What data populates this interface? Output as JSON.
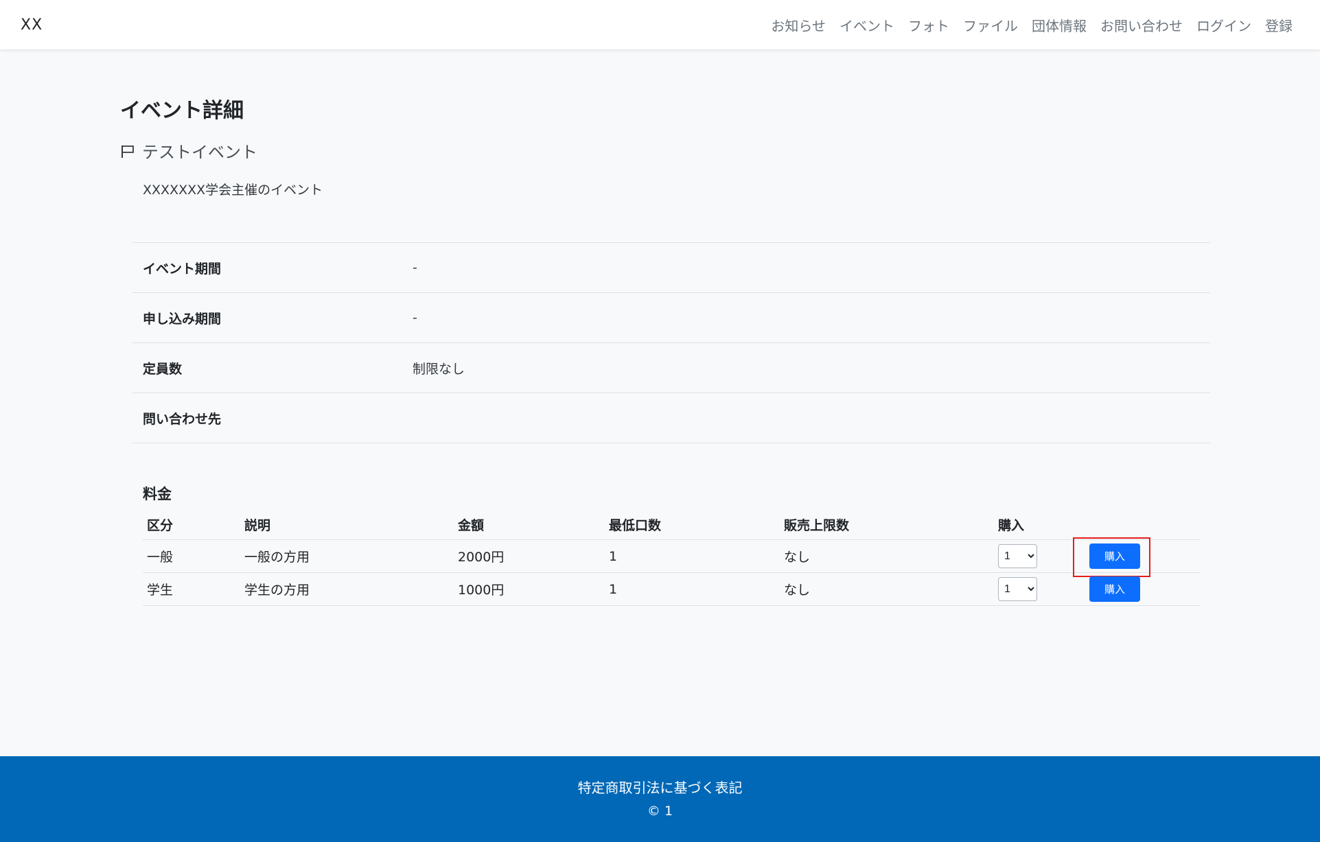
{
  "nav": {
    "brand": "XX",
    "links": [
      "お知らせ",
      "イベント",
      "フォト",
      "ファイル",
      "団体情報",
      "お問い合わせ",
      "ログイン",
      "登録"
    ]
  },
  "page": {
    "title": "イベント詳細",
    "event_name": "テストイベント",
    "event_description": "XXXXXXX学会主催のイベント"
  },
  "info": [
    {
      "label": "イベント期間",
      "value": "-"
    },
    {
      "label": "申し込み期間",
      "value": "-"
    },
    {
      "label": "定員数",
      "value": "制限なし"
    },
    {
      "label": "問い合わせ先",
      "value": ""
    }
  ],
  "pricing": {
    "title": "料金",
    "headers": [
      "区分",
      "説明",
      "金額",
      "最低口数",
      "販売上限数",
      "購入"
    ],
    "rows": [
      {
        "category": "一般",
        "description": "一般の方用",
        "amount": "2000円",
        "min_units": "1",
        "limit": "なし",
        "qty": "1",
        "buy_label": "購入"
      },
      {
        "category": "学生",
        "description": "学生の方用",
        "amount": "1000円",
        "min_units": "1",
        "limit": "なし",
        "qty": "1",
        "buy_label": "購入"
      }
    ]
  },
  "footer": {
    "link": "特定商取引法に基づく表記",
    "copyright": "© 1"
  },
  "colors": {
    "primary_button": "#0d6efd",
    "footer_bg": "#0068b7",
    "highlight": "#e51d1d"
  },
  "icons": {
    "event_marker": "flag-icon"
  }
}
